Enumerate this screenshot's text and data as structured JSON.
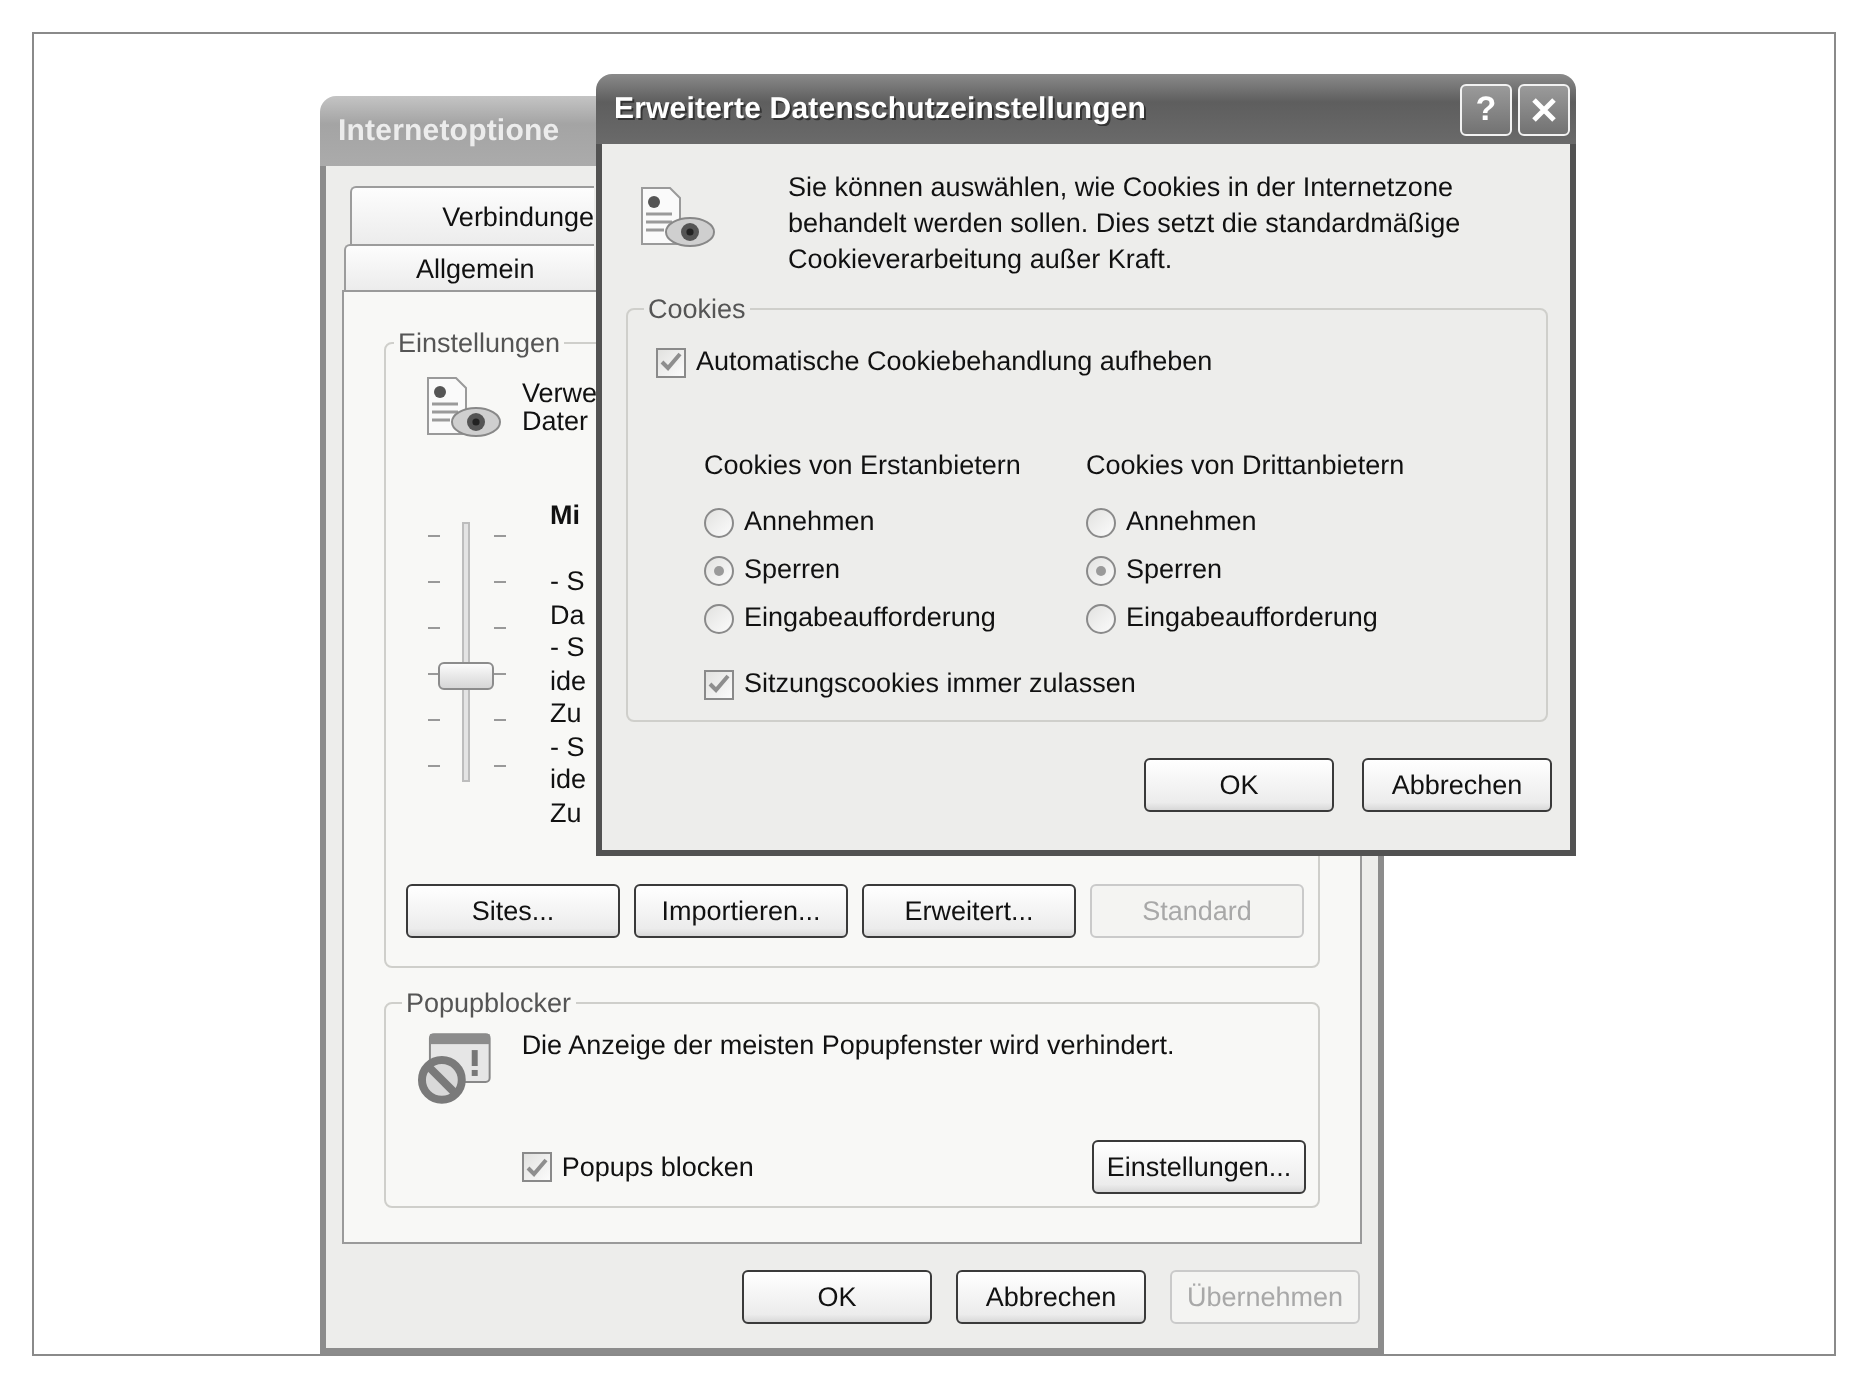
{
  "background_window": {
    "title": "Internetoptione",
    "tab_rows": [
      {
        "tabs": [
          {
            "label": "Verbindunge",
            "selected": false
          }
        ]
      },
      {
        "tabs": [
          {
            "label": "Allgemein",
            "selected": false
          }
        ]
      }
    ],
    "settings_group": {
      "legend": "Einstellungen",
      "description_lines": [
        "Verwe",
        "Dater"
      ],
      "level_title": "Mi",
      "level_lines": [
        "- S",
        "Da",
        "- S",
        "ide",
        "Zu",
        "- S",
        "ide",
        "Zu"
      ],
      "slider": {
        "level": 0.4
      },
      "buttons": [
        {
          "label": "Sites...",
          "disabled": false
        },
        {
          "label": "Importieren...",
          "disabled": false
        },
        {
          "label": "Erweitert...",
          "disabled": false
        },
        {
          "label": "Standard",
          "disabled": true
        }
      ]
    },
    "popup_group": {
      "legend": "Popupblocker",
      "description": "Die Anzeige der meisten Popupfenster wird verhindert.",
      "checkbox": {
        "label": "Popups blocken",
        "checked": true
      },
      "button": {
        "label": "Einstellungen...",
        "disabled": false
      }
    },
    "buttons": [
      {
        "label": "OK",
        "disabled": false
      },
      {
        "label": "Abbrechen",
        "disabled": false
      },
      {
        "label": "Übernehmen",
        "disabled": true
      }
    ]
  },
  "dialog": {
    "title": "Erweiterte Datenschutzeinstellungen",
    "help_button": "?",
    "intro": "Sie können auswählen, wie Cookies in der Internetzone behandelt werden sollen. Dies setzt die standardmäßige Cookieverarbeitung außer Kraft.",
    "cookies_group": {
      "legend": "Cookies",
      "override": {
        "label": "Automatische Cookiebehandlung aufheben",
        "checked": true
      },
      "columns": [
        {
          "heading": "Cookies von Erstanbietern",
          "options": [
            {
              "label": "Annehmen",
              "selected": false
            },
            {
              "label": "Sperren",
              "selected": true
            },
            {
              "label": "Eingabeaufforderung",
              "selected": false
            }
          ]
        },
        {
          "heading": "Cookies von Drittanbietern",
          "options": [
            {
              "label": "Annehmen",
              "selected": false
            },
            {
              "label": "Sperren",
              "selected": true
            },
            {
              "label": "Eingabeaufforderung",
              "selected": false
            }
          ]
        }
      ],
      "session": {
        "label": "Sitzungscookies immer zulassen",
        "checked": true
      }
    },
    "buttons": [
      {
        "label": "OK",
        "disabled": false
      },
      {
        "label": "Abbrechen",
        "disabled": false
      }
    ]
  }
}
